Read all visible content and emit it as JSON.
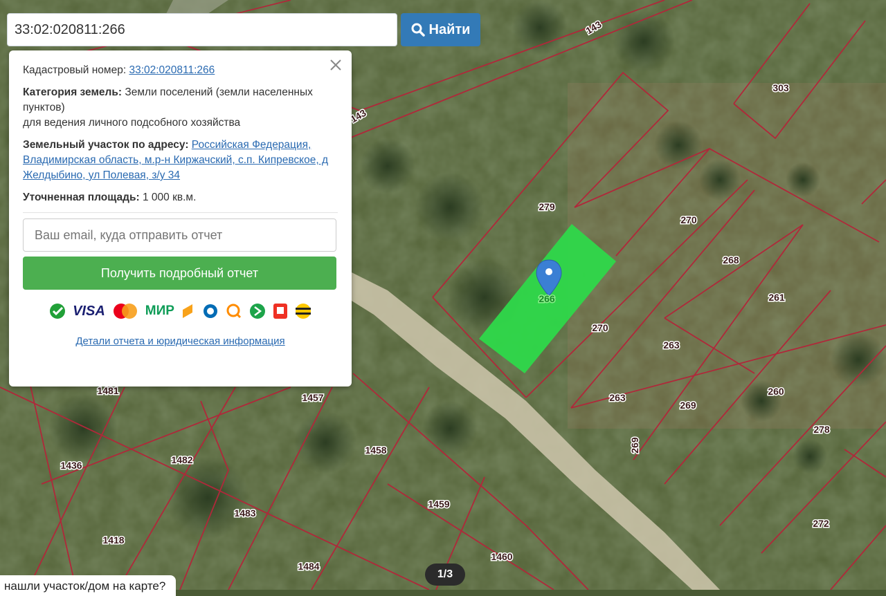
{
  "search": {
    "value": "33:02:020811:266",
    "button_label": "Найти"
  },
  "popup": {
    "cadastral_label": "Кадастровый номер:",
    "cadastral_value": "33:02:020811:266",
    "category_label": "Категория земель:",
    "category_value": "Земли поселений (земли населенных пунктов)",
    "category_use": "для ведения личного подсобного хозяйства",
    "address_label": "Земельный участок по адресу:",
    "address_value": "Российская Федерация, Владимирская область, м.р-н Киржачский, с.п. Кипревское, д Желдыбино, ул Полевая, з/у 34",
    "area_label": "Уточненная площадь:",
    "area_value": "1 000 кв.м.",
    "email_placeholder": "Ваш email, куда отправить отчет",
    "report_button": "Получить подробный отчет",
    "details_link": "Детали отчета и юридическая информация"
  },
  "payment_icons": [
    "sberbank-icon",
    "visa-icon",
    "mastercard-icon",
    "mir-icon",
    "yandex-money-icon",
    "webmoney-icon",
    "qiwi-icon",
    "sbp-icon",
    "alfa-icon",
    "beeline-icon"
  ],
  "payment_text": {
    "visa": "VISA",
    "mir": "МИР"
  },
  "map": {
    "parcel_labels": [
      "143",
      "143",
      "303",
      "279",
      "270",
      "268",
      "261",
      "266",
      "270",
      "263",
      "260",
      "263",
      "269",
      "278",
      "269",
      "272",
      "1481",
      "1457",
      "1436",
      "1482",
      "1458",
      "1483",
      "1459",
      "1418",
      "1484",
      "1460"
    ],
    "highlight_color": "#2ed84a",
    "boundary_color": "#b0283a"
  },
  "pager": {
    "text": "1/3"
  },
  "banner": {
    "text": "нашли участок/дом на карте?"
  }
}
